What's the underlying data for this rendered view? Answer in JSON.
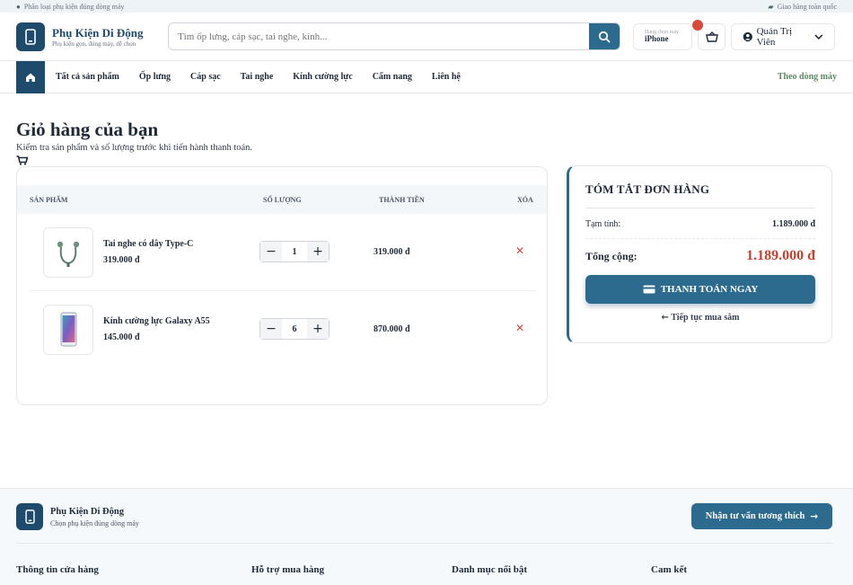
{
  "topbar": {
    "left": "Phân loại phụ kiện đúng dòng máy",
    "right": "Giao hàng toàn quốc"
  },
  "brand": {
    "name": "Phụ Kiện Di Động",
    "tagline": "Phụ kiện gọn, đúng máy, dễ chọn"
  },
  "search": {
    "placeholder": "Tìm ốp lưng, cáp sạc, tai nghe, kính..."
  },
  "phone_selector": {
    "label": "Đang chọn máy",
    "value": "iPhone"
  },
  "user": {
    "name": "Quản Trị Viên"
  },
  "nav": {
    "items": [
      "Tất cả sản phẩm",
      "Ốp lưng",
      "Cáp sạc",
      "Tai nghe",
      "Kính cường lực",
      "Cẩm nang",
      "Liên hệ"
    ],
    "right": "Theo dòng máy"
  },
  "page": {
    "title": "Giỏ hàng của bạn",
    "subtitle": "Kiểm tra sản phẩm và số lượng trước khi tiến hành thanh toán."
  },
  "table": {
    "headers": [
      "SẢN PHẨM",
      "SỐ LƯỢNG",
      "THÀNH TIỀN",
      "XÓA"
    ],
    "rows": [
      {
        "name": "Tai nghe có dây Type-C",
        "price": "319.000 đ",
        "qty": "1",
        "subtotal": "319.000 đ"
      },
      {
        "name": "Kính cường lực Galaxy A55",
        "price": "145.000 đ",
        "qty": "6",
        "subtotal": "870.000 đ"
      }
    ]
  },
  "summary": {
    "title": "TÓM TẮT ĐƠN HÀNG",
    "subtotal_label": "Tạm tính:",
    "subtotal_value": "1.189.000 đ",
    "total_label": "Tổng cộng:",
    "total_value": "1.189.000 đ",
    "checkout_label": "THANH TOÁN NGAY",
    "continue_label": "Tiếp tục mua sắm"
  },
  "footer": {
    "brand": "Phụ Kiện Di Động",
    "tagline": "Chọn phụ kiện đúng dòng máy",
    "cta": "Nhận tư vấn tương thích",
    "columns": [
      "Thông tin cửa hàng",
      "Hỗ trợ mua hàng",
      "Danh mục nổi bật",
      "Cam kết"
    ]
  },
  "colors": {
    "primary": "#1e4a6b",
    "accent": "#2c6a8e",
    "danger": "#d94a3c",
    "total": "#c8402f"
  }
}
